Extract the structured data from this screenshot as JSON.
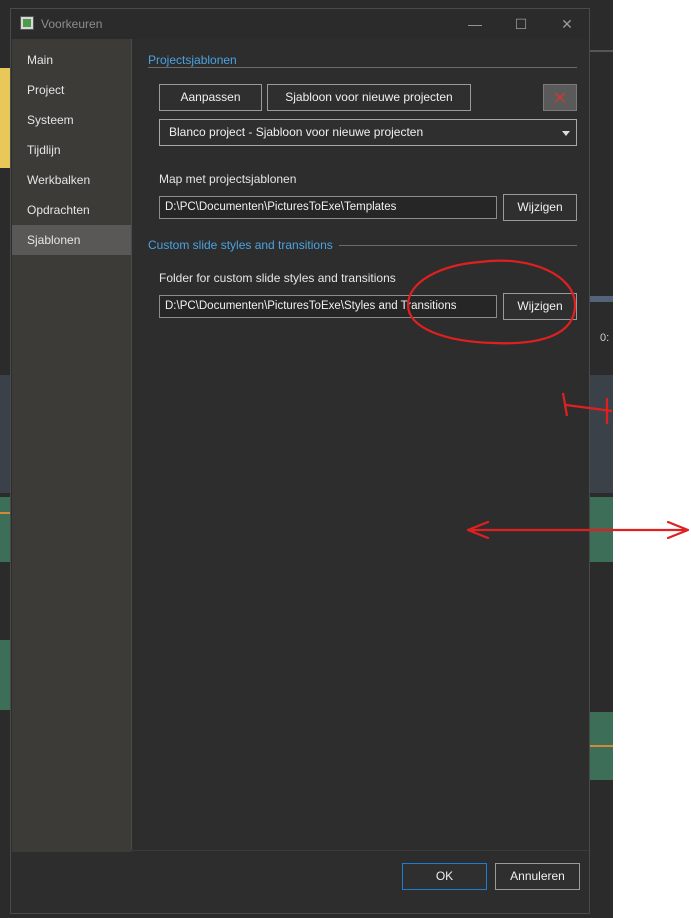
{
  "window": {
    "title": "Voorkeuren",
    "min_glyph": "—",
    "max_glyph": "☐",
    "close_glyph": "✕"
  },
  "sidebar": {
    "items": [
      {
        "label": "Main"
      },
      {
        "label": "Project"
      },
      {
        "label": "Systeem"
      },
      {
        "label": "Tijdlijn"
      },
      {
        "label": "Werkbalken"
      },
      {
        "label": "Opdrachten"
      },
      {
        "label": "Sjablonen"
      }
    ],
    "active": "Sjablonen"
  },
  "project_templates": {
    "title": "Projectsjablonen",
    "customize_label": "Aanpassen",
    "new_template_label": "Sjabloon voor nieuwe projecten",
    "selected_template": "Blanco project - Sjabloon voor nieuwe projecten",
    "folder_label": "Map met projectsjablonen",
    "folder_path": "D:\\PC\\Documenten\\PicturesToExe\\Templates",
    "change_label": "Wijzigen"
  },
  "custom_styles": {
    "title": "Custom slide styles and transitions",
    "folder_label": "Folder for custom slide styles and transitions",
    "folder_path": "D:\\PC\\Documenten\\PicturesToExe\\Styles and Transitions",
    "change_label": "Wijzigen"
  },
  "footer": {
    "ok_label": "OK",
    "cancel_label": "Annuleren"
  },
  "background_app": {
    "timeline_label": "0:"
  },
  "colors": {
    "accent": "#4aa3e0",
    "annotation": "#e02020",
    "ok_border": "#1e7bd6"
  }
}
